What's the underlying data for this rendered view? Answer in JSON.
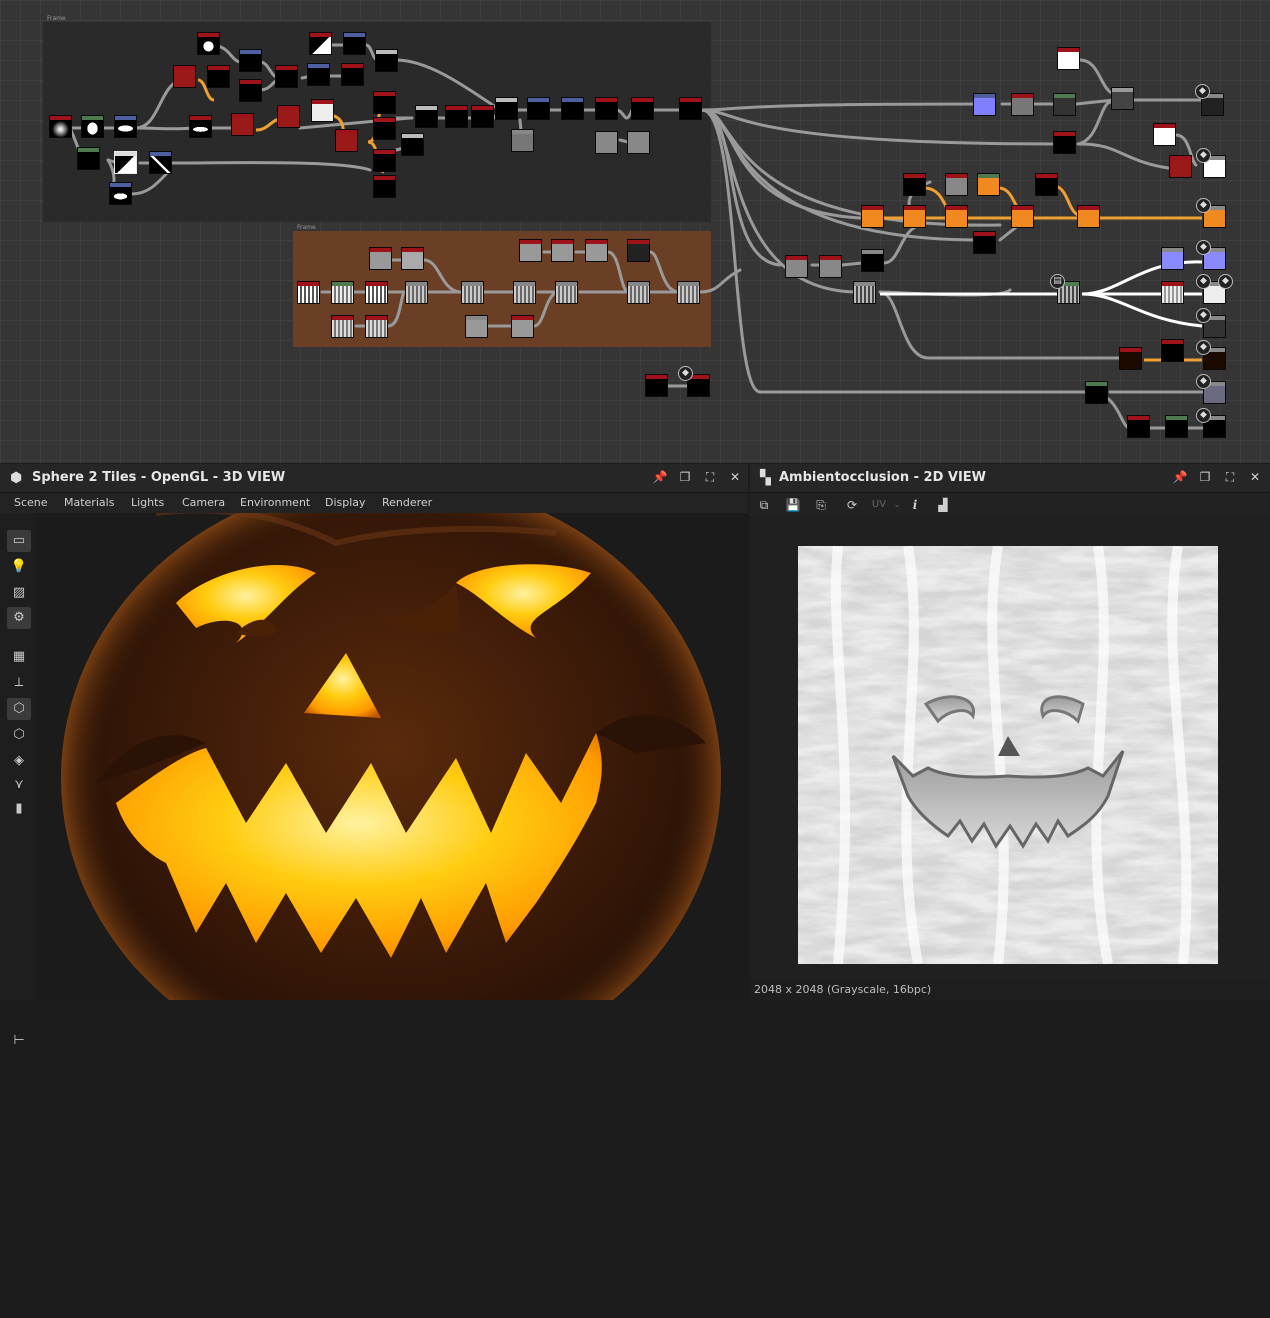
{
  "graph": {
    "frames": [
      {
        "label": "Frame",
        "color": "#2a2a2a"
      },
      {
        "label": "Frame",
        "color": "#6b3f25"
      }
    ]
  },
  "panel3d": {
    "title": "Sphere 2 Tiles - OpenGL - 3D VIEW",
    "menu": [
      "Scene",
      "Materials",
      "Lights",
      "Camera",
      "Environment",
      "Display",
      "Renderer"
    ],
    "tools": [
      "camera-icon",
      "light-bulb-icon",
      "environment-icon",
      "settings-icon",
      "grid-icon",
      "axis-icon",
      "cube-icon",
      "wireframe-cube-icon",
      "layers-icon",
      "tripod-icon",
      "stats-icon",
      "tree-icon"
    ]
  },
  "panel2d": {
    "title": "Ambientocclusion - 2D VIEW",
    "uv_label": "UV",
    "info_label": "i",
    "status": "2048 x 2048 (Grayscale, 16bpc)"
  },
  "colors": {
    "node_red": "#a01219",
    "node_blue": "#4d5f9e",
    "node_green": "#4f7a4f",
    "wire": "#9a9a9a",
    "wire_orange": "#f0a030",
    "pumpkin_glow": "#ffb000"
  }
}
